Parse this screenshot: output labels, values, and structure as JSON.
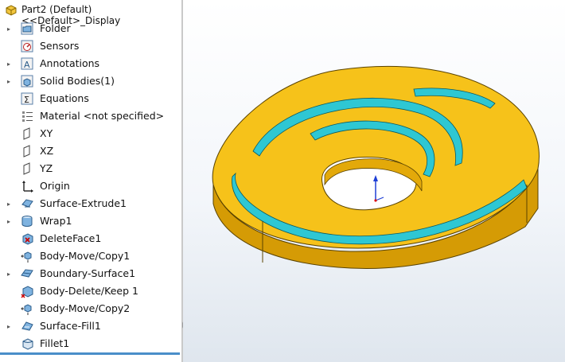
{
  "tree": {
    "part_title": "Part2 (Default) <<Default>_Display",
    "items": [
      {
        "label": "Folder",
        "icon": "folder-icon",
        "expandable": true
      },
      {
        "label": "Sensors",
        "icon": "sensor-icon",
        "expandable": false
      },
      {
        "label": "Annotations",
        "icon": "annotation-icon",
        "expandable": true
      },
      {
        "label": "Solid Bodies(1)",
        "icon": "solid-bodies-icon",
        "expandable": true
      },
      {
        "label": "Equations",
        "icon": "equations-icon",
        "expandable": false
      },
      {
        "label": "Material <not specified>",
        "icon": "material-icon",
        "expandable": false
      },
      {
        "label": "XY",
        "icon": "plane-icon",
        "expandable": false
      },
      {
        "label": "XZ",
        "icon": "plane-icon",
        "expandable": false
      },
      {
        "label": "YZ",
        "icon": "plane-icon",
        "expandable": false
      },
      {
        "label": "Origin",
        "icon": "origin-icon",
        "expandable": false
      },
      {
        "label": "Surface-Extrude1",
        "icon": "surface-extrude-icon",
        "expandable": true
      },
      {
        "label": "Wrap1",
        "icon": "wrap-icon",
        "expandable": true
      },
      {
        "label": "DeleteFace1",
        "icon": "delete-face-icon",
        "expandable": false
      },
      {
        "label": "Body-Move/Copy1",
        "icon": "body-move-icon",
        "expandable": false
      },
      {
        "label": "Boundary-Surface1",
        "icon": "boundary-surface-icon",
        "expandable": true
      },
      {
        "label": "Body-Delete/Keep 1",
        "icon": "body-delete-icon",
        "expandable": false
      },
      {
        "label": "Body-Move/Copy2",
        "icon": "body-move-icon",
        "expandable": false
      },
      {
        "label": "Surface-Fill1",
        "icon": "surface-fill-icon",
        "expandable": true
      },
      {
        "label": "Fillet1",
        "icon": "fillet-icon",
        "expandable": false
      }
    ]
  },
  "colors": {
    "model_yellow": "#f6c21a",
    "model_shadow": "#d59b05",
    "groove_cyan": "#2ec7d3",
    "selection_blue": "#4a8ec9",
    "triad_blue": "#1d3fd6"
  }
}
